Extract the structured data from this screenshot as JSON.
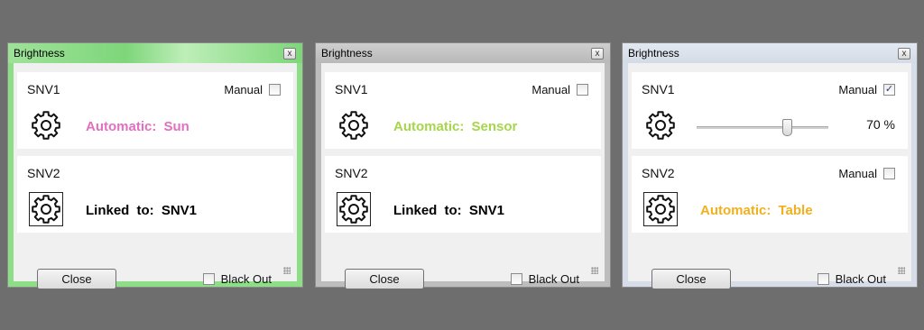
{
  "dialogs": [
    {
      "title": "Brightness",
      "close_glyph": "x",
      "snv1": {
        "label": "SNV1",
        "manual_label": "Manual",
        "manual_checked": false,
        "status": "Automatic:  Sun",
        "status_color": "#e36fbf",
        "icon": "gear-icon"
      },
      "snv2": {
        "label": "SNV2",
        "status": "Linked to:  SNV1",
        "status_color": "#000000",
        "icon": "gear-icon"
      },
      "close_button": "Close",
      "blackout_label": "Black Out",
      "blackout_checked": false,
      "frame_color": "#8ede88"
    },
    {
      "title": "Brightness",
      "close_glyph": "x",
      "snv1": {
        "label": "SNV1",
        "manual_label": "Manual",
        "manual_checked": false,
        "status": "Automatic:  Sensor",
        "status_color": "#a6d64a",
        "icon": "gear-icon"
      },
      "snv2": {
        "label": "SNV2",
        "status": "Linked to:  SNV1",
        "status_color": "#000000",
        "icon": "gear-icon"
      },
      "close_button": "Close",
      "blackout_label": "Black Out",
      "blackout_checked": false,
      "frame_color": "#bdbdbd"
    },
    {
      "title": "Brightness",
      "close_glyph": "x",
      "snv1": {
        "label": "SNV1",
        "manual_label": "Manual",
        "manual_checked": true,
        "slider_value": 0.7,
        "percent_text": "70 %",
        "icon": "gear-icon"
      },
      "snv2": {
        "label": "SNV2",
        "manual_label": "Manual",
        "manual_checked": false,
        "status": "Automatic:  Table",
        "status_color": "#f2b01e",
        "icon": "gear-icon"
      },
      "close_button": "Close",
      "blackout_label": "Black Out",
      "blackout_checked": false,
      "frame_color": "#d6dde8"
    }
  ]
}
